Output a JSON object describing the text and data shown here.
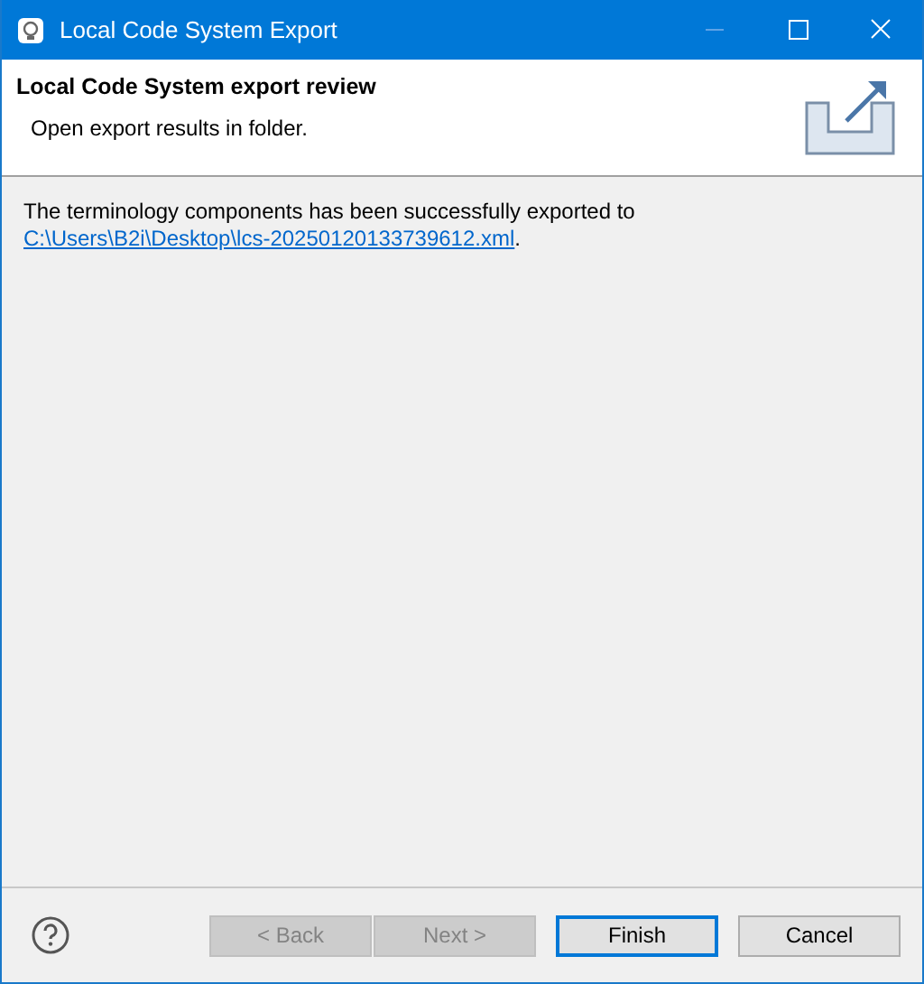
{
  "window": {
    "title": "Local Code System Export"
  },
  "header": {
    "title": "Local Code System export review",
    "description": "Open export results in folder."
  },
  "message": {
    "text": "The terminology components has been successfully exported to",
    "link": "C:\\Users\\B2i\\Desktop\\lcs-20250120133739612.xml",
    "suffix": "."
  },
  "buttons": [
    {
      "label": "< Back",
      "disabled": true,
      "default": false
    },
    {
      "label": "Next >",
      "disabled": true,
      "default": false
    },
    {
      "label": "Finish",
      "disabled": false,
      "default": true
    },
    {
      "label": "Cancel",
      "disabled": false,
      "default": false
    }
  ]
}
